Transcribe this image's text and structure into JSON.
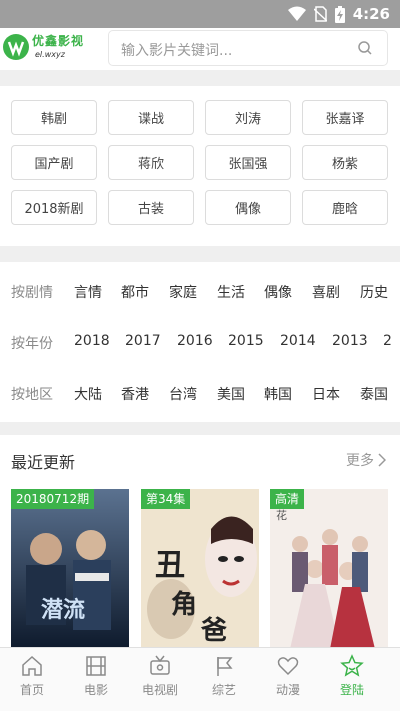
{
  "statusbar": {
    "time": "4:26",
    "icons": [
      "wifi-icon",
      "no-sim-icon",
      "battery-charging-icon"
    ]
  },
  "header": {
    "logo_name": "优鑫影视",
    "logo_url": "el.wxyz",
    "search_placeholder": "输入影片关键词..."
  },
  "hot_tags": [
    "韩剧",
    "谍战",
    "刘涛",
    "张嘉译",
    "国产剧",
    "蒋欣",
    "张国强",
    "杨紫",
    "2018新剧",
    "古装",
    "偶像",
    "鹿晗"
  ],
  "filters": {
    "genre": {
      "label": "按剧情",
      "items": [
        "言情",
        "都市",
        "家庭",
        "生活",
        "偶像",
        "喜剧",
        "历史"
      ]
    },
    "year": {
      "label": "按年份",
      "items": [
        "2018",
        "2017",
        "2016",
        "2015",
        "2014",
        "2013",
        "2"
      ]
    },
    "region": {
      "label": "按地区",
      "items": [
        "大陆",
        "香港",
        "台湾",
        "美国",
        "韩国",
        "日本",
        "泰国"
      ]
    }
  },
  "recent": {
    "title": "最近更新",
    "more_label": "更多",
    "posters": [
      {
        "badge": "20180712期",
        "colors": [
          "#3d5a80",
          "#0f1e33"
        ]
      },
      {
        "badge": "第34集",
        "colors": [
          "#e8d9bf",
          "#3a2a22"
        ]
      },
      {
        "badge": "高清",
        "colors": [
          "#f5efe8",
          "#b7a8a6"
        ]
      }
    ]
  },
  "tabs": [
    {
      "label": "首页",
      "icon": "home-icon"
    },
    {
      "label": "电影",
      "icon": "film-icon"
    },
    {
      "label": "电视剧",
      "icon": "tv-icon"
    },
    {
      "label": "综艺",
      "icon": "flag-icon"
    },
    {
      "label": "动漫",
      "icon": "heart-icon"
    },
    {
      "label": "登陆",
      "icon": "star-icon"
    }
  ],
  "active_tab": "登陆",
  "colors": {
    "accent": "#3cb34a",
    "statusbar": "#9e9e9e"
  }
}
